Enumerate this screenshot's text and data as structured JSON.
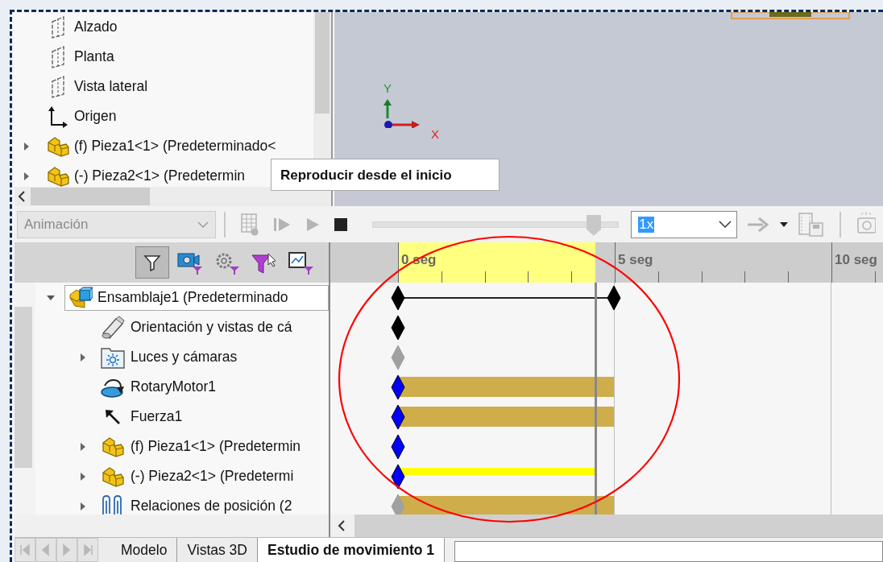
{
  "feature_tree": {
    "items": [
      {
        "kind": "plane",
        "label": "Alzado",
        "expandable": false
      },
      {
        "kind": "plane",
        "label": "Planta",
        "expandable": false
      },
      {
        "kind": "plane",
        "label": "Vista lateral",
        "expandable": false
      },
      {
        "kind": "origin",
        "label": "Origen",
        "expandable": false
      },
      {
        "kind": "part",
        "label": "(f) Pieza1<1> (Predeterminado<",
        "expandable": true
      },
      {
        "kind": "part",
        "label": "(-) Pieza2<1> (Predetermin",
        "expandable": true
      }
    ]
  },
  "viewport": {
    "tooltip": "Reproducir desde el inicio",
    "triad": {
      "x_label": "X",
      "y_label": "Y"
    }
  },
  "toolbar": {
    "study_type": {
      "value": "Animación",
      "disabled": true
    },
    "buttons": [
      {
        "kind": "calc",
        "disabled": true
      },
      {
        "kind": "play-start",
        "disabled": true
      },
      {
        "kind": "play",
        "disabled": true
      },
      {
        "kind": "stop",
        "disabled": false
      }
    ],
    "slider": {
      "level": 0.9
    },
    "speed": {
      "value": "1x"
    },
    "tail_buttons": [
      {
        "kind": "arrow",
        "disabled": true
      },
      {
        "kind": "caret",
        "disabled": false
      },
      {
        "kind": "save-film",
        "disabled": true
      },
      {
        "kind": "camera",
        "disabled": true
      }
    ]
  },
  "filters": [
    {
      "kind": "filter",
      "selected": true
    },
    {
      "kind": "camera",
      "selected": false
    },
    {
      "kind": "gear",
      "selected": false
    },
    {
      "kind": "pointer",
      "selected": false
    },
    {
      "kind": "chart",
      "selected": false
    }
  ],
  "motion_tree": {
    "root": {
      "label": "Ensamblaje1  (Predeterminado",
      "expanded": true,
      "selected": true
    },
    "children": [
      {
        "kind": "camera",
        "label": "Orientación y vistas de cá",
        "expandable": false
      },
      {
        "kind": "lights",
        "label": "Luces y cámaras",
        "expandable": true
      },
      {
        "kind": "motor",
        "label": "RotaryMotor1",
        "expandable": false
      },
      {
        "kind": "force",
        "label": "Fuerza1",
        "expandable": false
      },
      {
        "kind": "part",
        "label": "(f) Pieza1<1> (Predetermin",
        "expandable": true
      },
      {
        "kind": "part",
        "label": "(-) Pieza2<1> (Predetermi",
        "expandable": true
      },
      {
        "kind": "mates",
        "label": "Relaciones de posición (2",
        "expandable": true
      }
    ]
  },
  "timeline": {
    "labels": [
      "0 seg",
      "5 seg",
      "10 seg"
    ],
    "rows": [
      {
        "kind": "connector",
        "keys": [
          {
            "color": "#000000"
          },
          {
            "color": "#000000"
          }
        ]
      },
      {
        "kind": "key",
        "keys": [
          {
            "color": "#000000"
          }
        ]
      },
      {
        "kind": "key",
        "keys": [
          {
            "color": "#a0a0a0"
          }
        ]
      },
      {
        "kind": "band",
        "keys": [
          {
            "color": "#0000ff"
          }
        ]
      },
      {
        "kind": "band",
        "keys": [
          {
            "color": "#0000ff"
          }
        ]
      },
      {
        "kind": "key",
        "keys": [
          {
            "color": "#0000ff"
          }
        ]
      },
      {
        "kind": "stripe",
        "keys": [
          {
            "color": "#0000ff"
          }
        ]
      },
      {
        "kind": "band",
        "keys": [
          {
            "color": "#a0a0a0"
          }
        ]
      }
    ]
  },
  "tabs": [
    {
      "label": "Modelo",
      "selected": false
    },
    {
      "label": "Vistas 3D",
      "selected": false
    },
    {
      "label": "Estudio de movimiento 1",
      "selected": true
    }
  ]
}
